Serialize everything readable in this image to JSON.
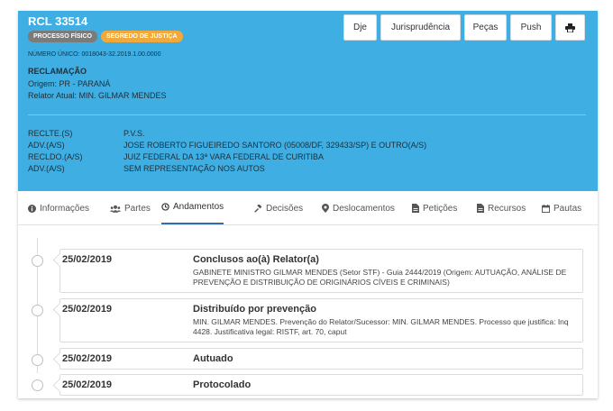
{
  "header": {
    "case_number": "RCL 33514",
    "badges": [
      "PROCESSO FÍSICO",
      "SEGREDO DE JUSTIÇA"
    ],
    "unique_number": "NÚMERO ÚNICO: 0018043-32.2019.1.00.0000",
    "classe": "RECLAMAÇÃO",
    "origem": "Origem: PR - PARANÁ",
    "relator": "Relator Atual: MIN. GILMAR MENDES",
    "actions": [
      "Dje",
      "Jurisprudência",
      "Peças",
      "Push"
    ],
    "print_icon": "printer-icon"
  },
  "parties": [
    {
      "role": "RECLTE.(S)",
      "name": "P.V.S."
    },
    {
      "role": "ADV.(A/S)",
      "name": "JOSE ROBERTO FIGUEIREDO SANTORO (05008/DF, 329433/SP) E OUTRO(A/S)"
    },
    {
      "role": "RECLDO.(A/S)",
      "name": "JUIZ FEDERAL DA 13ª VARA FEDERAL DE CURITIBA"
    },
    {
      "role": "ADV.(A/S)",
      "name": "SEM REPRESENTAÇÃO NOS AUTOS"
    }
  ],
  "tabs": [
    {
      "label": "Informações",
      "icon": "info-icon"
    },
    {
      "label": "Partes",
      "icon": "users-icon"
    },
    {
      "label": "Andamentos",
      "icon": "history-icon",
      "active": true
    },
    {
      "label": "Decisões",
      "icon": "gavel-icon"
    },
    {
      "label": "Deslocamentos",
      "icon": "map-marker-icon"
    },
    {
      "label": "Petições",
      "icon": "file-icon"
    },
    {
      "label": "Recursos",
      "icon": "file-icon"
    },
    {
      "label": "Pautas",
      "icon": "calendar-icon"
    }
  ],
  "entries": [
    {
      "date": "25/02/2019",
      "title": "Conclusos ao(à) Relator(a)",
      "description": "GABINETE MINISTRO GILMAR MENDES (Setor STF) - Guia 2444/2019 (Origem: AUTUAÇÃO, ANÁLISE DE PREVENÇÃO E DISTRIBUIÇÃO DE ORIGINÁRIOS CÍVEIS E CRIMINAIS)"
    },
    {
      "date": "25/02/2019",
      "title": "Distribuído por prevenção",
      "description": "MIN. GILMAR MENDES. Prevenção do Relator/Sucessor: MIN. GILMAR MENDES. Processo que justifica: Inq 4428. Justificativa legal: RISTF, art. 70, caput"
    },
    {
      "date": "25/02/2019",
      "title": "Autuado",
      "description": ""
    },
    {
      "date": "25/02/2019",
      "title": "Protocolado",
      "description": ""
    }
  ],
  "colors": {
    "header_bg": "#3faee3",
    "badge_grey": "#7b7b7b",
    "badge_orange": "#f0a93a",
    "active_tab_underline": "#2b6fb0"
  }
}
